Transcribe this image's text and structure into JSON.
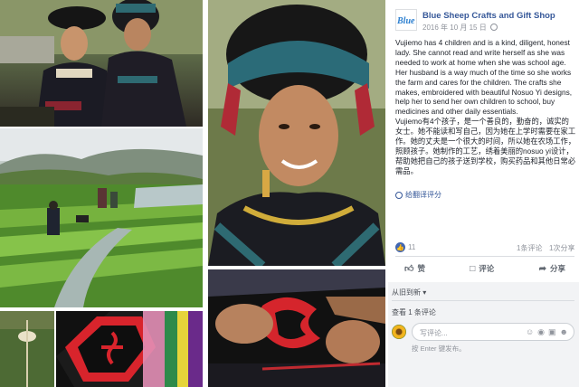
{
  "post": {
    "page_name": "Blue Sheep Crafts and Gift Shop",
    "logo_text": "Blue",
    "timestamp": "2016 年 10 月 15 日",
    "body_en": "Vujiemo has 4 children and is a kind, diligent, honest lady. She cannot read and write herself as she was needed to work at home when she was school age. Her husband is a way much of the time so she works the farm and cares for the children. The crafts she makes, embroidered with beautiful Nosuo Yi designs, help her to send her own children to school, buy medicines and other daily essentials.",
    "body_zh": "Vujiemo有4个孩子，是一个善良的，勤奋的，诚实的女士。她不能读和写自己，因为她在上学时需要在家工作。她的丈夫是一个很大的时间，所以她在农场工作，照顾孩子。她制作的工艺，绣着美丽的nosuo yi设计，帮助她把自己的孩子送到学校，购买药品和其他日常必需品。",
    "see_translation": "给翻译评分"
  },
  "reactions": {
    "like_count": "11",
    "comments": "1条评论",
    "shares": "1次分享"
  },
  "actions": {
    "like": "赞",
    "comment": "评论",
    "share": "分享"
  },
  "comments": {
    "sort_label": "从旧到新 ▾",
    "view_label": "查看 1 条评论",
    "input_placeholder": "写评论...",
    "hint": "按 Enter 键发布。"
  },
  "icons": {
    "like": "thumbs-up-icon",
    "comment": "speech-bubble-icon",
    "share": "share-arrow-icon",
    "globe": "globe-icon"
  },
  "colors": {
    "link": "#365899",
    "like_blue": "#4267b2",
    "muted": "#90949c"
  }
}
